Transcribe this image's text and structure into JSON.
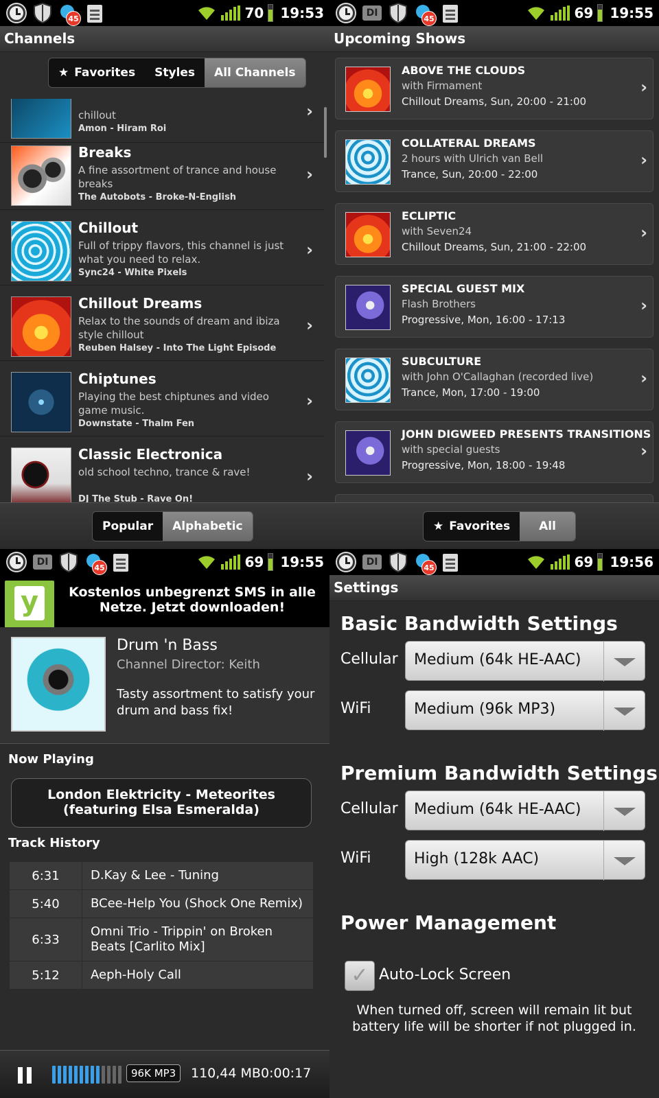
{
  "status_bars": [
    {
      "notif_count": "45",
      "battery": "70",
      "time": "19:53"
    },
    {
      "notif_count": "45",
      "battery": "69",
      "time": "19:55"
    },
    {
      "notif_count": "45",
      "battery": "69",
      "time": "19:55"
    },
    {
      "notif_count": "45",
      "battery": "69",
      "time": "19:56"
    }
  ],
  "status_di_label": "DI",
  "channels": {
    "title": "Channels",
    "tabs": [
      "Favorites",
      "Styles",
      "All Channels"
    ],
    "active_tab": "All Channels",
    "list": [
      {
        "name": "",
        "desc": "chillout",
        "track": "Amon - Hiram Roi",
        "art": "cube"
      },
      {
        "name": "Breaks",
        "desc": "A fine assortment of trance and house breaks",
        "track": "The Autobots - Broke-N-English",
        "art": "breaks"
      },
      {
        "name": "Chillout",
        "desc": "Full of trippy flavors, this channel is just what you need to relax.",
        "track": "Sync24 - White Pixels",
        "art": "blue"
      },
      {
        "name": "Chillout Dreams",
        "desc": "Relax to the sounds of dream and ibiza style chillout",
        "track": "Reuben Halsey - Into The Light Episode",
        "art": "sunset"
      },
      {
        "name": "Chiptunes",
        "desc": "Playing the best chiptunes and video game music.",
        "track": "Downstate - Thalm Fen",
        "art": "chip"
      },
      {
        "name": "Classic Electronica",
        "desc": "old school techno, trance & rave!",
        "track": "DJ The Stub - Rave On!",
        "art": "classic"
      }
    ],
    "sort_tabs": [
      "Popular",
      "Alphabetic"
    ],
    "active_sort": "Alphabetic"
  },
  "upcoming": {
    "title": "Upcoming Shows",
    "shows": [
      {
        "title": "ABOVE THE CLOUDS",
        "sub": "with Firmament",
        "when": "Chillout Dreams, Sun, 20:00 - 21:00",
        "art": "sunset"
      },
      {
        "title": "COLLATERAL DREAMS",
        "sub": "2 hours with Ulrich van Bell",
        "when": "Trance, Sun, 20:00 - 22:00",
        "art": "trance"
      },
      {
        "title": "ECLIPTIC",
        "sub": "with Seven24",
        "when": "Chillout Dreams, Sun, 21:00 - 22:00",
        "art": "sunset"
      },
      {
        "title": "SPECIAL GUEST MIX",
        "sub": "Flash Brothers",
        "when": "Progressive, Mon, 16:00 - 17:13",
        "art": "prog"
      },
      {
        "title": "SUBCULTURE",
        "sub": "with John O'Callaghan (recorded live)",
        "when": "Trance, Mon, 17:00 - 19:00",
        "art": "trance"
      },
      {
        "title": "JOHN DIGWEED PRESENTS TRANSITIONS",
        "sub": "with special guests",
        "when": "Progressive, Mon, 18:00 - 19:48",
        "art": "prog"
      }
    ],
    "filter_tabs": [
      "Favorites",
      "All"
    ],
    "active_filter": "All"
  },
  "now_playing": {
    "ad_logo": "y",
    "ad_text": "Kostenlos unbegrenzt SMS in alle Netze. Jetzt downloaden!",
    "channel": "Drum 'n Bass",
    "director": "Channel Director: Keith",
    "description": "Tasty assortment to satisfy your drum and bass fix!",
    "now_label": "Now Playing",
    "current_track": "London Elektricity - Meteorites (featuring Elsa Esmeralda)",
    "history_label": "Track History",
    "history": [
      {
        "duration": "6:31",
        "title": "D.Kay & Lee - Tuning"
      },
      {
        "duration": "5:40",
        "title": "BCee-Help You (Shock One Remix)"
      },
      {
        "duration": "6:33",
        "title": "Omni Trio - Trippin' on Broken Beats [Carlito Mix]"
      },
      {
        "duration": "5:12",
        "title": "Aeph-Holy Call"
      }
    ],
    "player": {
      "buffer_level": 0.7,
      "format": "96K MP3",
      "data_used": "110,44 MB",
      "elapsed": "0:00:17"
    }
  },
  "settings": {
    "title": "Settings",
    "basic_header": "Basic Bandwidth Settings",
    "premium_header": "Premium Bandwidth Settings",
    "power_header": "Power Management",
    "labels": {
      "cellular": "Cellular",
      "wifi": "WiFi"
    },
    "basic": {
      "cellular": "Medium (64k HE-AAC)",
      "wifi": "Medium (96k MP3)"
    },
    "premium": {
      "cellular": "Medium (64k HE-AAC)",
      "wifi": "High (128k AAC)"
    },
    "autolock_label": "Auto-Lock Screen",
    "autolock_checked": true,
    "autolock_note": "When turned off, screen will remain lit but battery life will be shorter if not plugged in."
  },
  "colors": {
    "signal_green": "#9ccd2a",
    "badge_red": "#e8382a",
    "accent_blue": "#3a9ee8",
    "ad_green": "#8bc43f"
  }
}
